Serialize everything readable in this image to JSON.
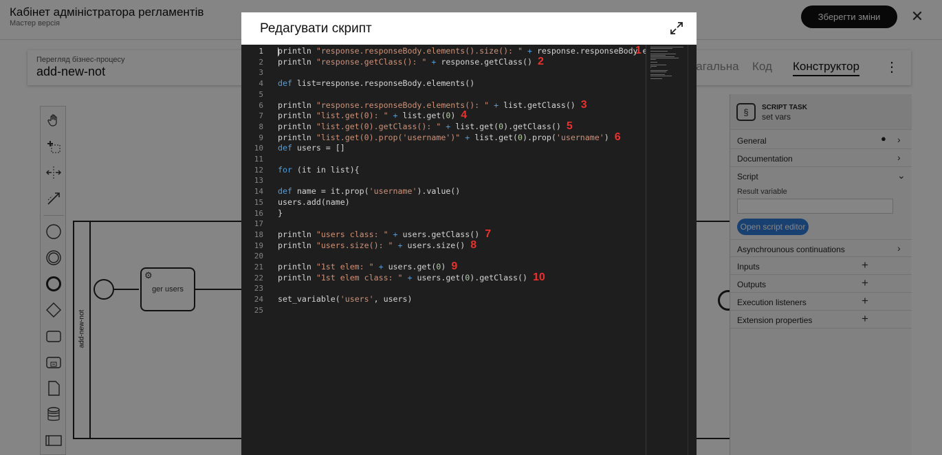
{
  "app": {
    "title": "Кабінет адміністратора регламентів",
    "subtitle": "Мастер версія",
    "save_label": "Зберегти зміни",
    "close_glyph": "✕"
  },
  "process": {
    "label": "Перегляд бізнес-процесу",
    "name": "add-new-not",
    "tabs": [
      "Загальна",
      "Код",
      "Конструктор"
    ],
    "active_tab": "Конструктор",
    "menu_glyph": "⋮"
  },
  "diagram": {
    "pool_name": "add-new-not",
    "task_name": "ger users"
  },
  "properties": {
    "type": "SCRIPT TASK",
    "name": "set vars",
    "groups": {
      "general": "General",
      "documentation": "Documentation",
      "script": "Script",
      "async": "Asynchrounous continuations",
      "inputs": "Inputs",
      "outputs": "Outputs",
      "listeners": "Execution listeners",
      "extensions": "Extension properties"
    },
    "result_variable_label": "Result variable",
    "result_variable_value": "",
    "open_editor_label": "Open script editor",
    "chevron_right": "›",
    "chevron_down": "⌄",
    "plus": "+",
    "dot": "●"
  },
  "modal": {
    "title": "Редагувати скрипт",
    "expand_icon": "expand-icon"
  },
  "editor": {
    "active_line": 1,
    "lines": [
      [
        [
          "kw0",
          "println "
        ],
        [
          "s",
          "\"response.responseBody.elements().size(): \""
        ],
        [
          "o",
          " + "
        ],
        [
          "p",
          "response.responseBody.elements"
        ]
      ],
      [
        [
          "p",
          "println "
        ],
        [
          "s",
          "\"response.getClass(): \""
        ],
        [
          "o",
          " + "
        ],
        [
          "p",
          "response.getClass()"
        ]
      ],
      [],
      [
        [
          "k",
          "def "
        ],
        [
          "p",
          "list=response.responseBody.elements()"
        ]
      ],
      [],
      [
        [
          "p",
          "println "
        ],
        [
          "s",
          "\"response.responseBody.elements(): \""
        ],
        [
          "o",
          " + "
        ],
        [
          "p",
          "list.getClass()"
        ]
      ],
      [
        [
          "p",
          "println "
        ],
        [
          "s",
          "\"list.get(0): \""
        ],
        [
          "o",
          " + "
        ],
        [
          "p",
          "list.get("
        ],
        [
          "n",
          "0"
        ],
        [
          "p",
          ")"
        ]
      ],
      [
        [
          "p",
          "println "
        ],
        [
          "s",
          "\"list.get(0).getClass(): \""
        ],
        [
          "o",
          " + "
        ],
        [
          "p",
          "list.get("
        ],
        [
          "n",
          "0"
        ],
        [
          "p",
          ").getClass()"
        ]
      ],
      [
        [
          "p",
          "println "
        ],
        [
          "s",
          "\"list.get(0).prop('username')\""
        ],
        [
          "o",
          " + "
        ],
        [
          "p",
          "list.get("
        ],
        [
          "n",
          "0"
        ],
        [
          "p",
          ").prop("
        ],
        [
          "s",
          "'username'"
        ],
        [
          "p",
          ")"
        ]
      ],
      [
        [
          "k",
          "def "
        ],
        [
          "p",
          "users = []"
        ]
      ],
      [],
      [
        [
          "k",
          "for "
        ],
        [
          "p",
          "(it in list){"
        ]
      ],
      [],
      [
        [
          "k",
          "def "
        ],
        [
          "p",
          "name = it.prop("
        ],
        [
          "s",
          "'username'"
        ],
        [
          "p",
          ").value()"
        ]
      ],
      [
        [
          "p",
          "users.add(name)"
        ]
      ],
      [
        [
          "p",
          "}"
        ]
      ],
      [],
      [
        [
          "p",
          "println "
        ],
        [
          "s",
          "\"users class: \""
        ],
        [
          "o",
          " + "
        ],
        [
          "p",
          "users.getClass()"
        ]
      ],
      [
        [
          "p",
          "println "
        ],
        [
          "s",
          "\"users.size(): \""
        ],
        [
          "o",
          " + "
        ],
        [
          "p",
          "users.size()"
        ]
      ],
      [],
      [
        [
          "p",
          "println "
        ],
        [
          "s",
          "\"1st elem: \""
        ],
        [
          "o",
          " + "
        ],
        [
          "p",
          "users.get("
        ],
        [
          "n",
          "0"
        ],
        [
          "p",
          ")"
        ]
      ],
      [
        [
          "p",
          "println "
        ],
        [
          "s",
          "\"1st elem class: \""
        ],
        [
          "o",
          " + "
        ],
        [
          "p",
          "users.get("
        ],
        [
          "n",
          "0"
        ],
        [
          "p",
          ").getClass()"
        ]
      ],
      [],
      [
        [
          "p",
          "set_variable("
        ],
        [
          "s",
          "'users'"
        ],
        [
          "p",
          ", users)"
        ]
      ],
      []
    ],
    "annotations": [
      {
        "line": 1,
        "text": "1"
      },
      {
        "line": 2,
        "text": "2"
      },
      {
        "line": 6,
        "text": "3"
      },
      {
        "line": 7,
        "text": "4"
      },
      {
        "line": 8,
        "text": "5"
      },
      {
        "line": 9,
        "text": "6"
      },
      {
        "line": 18,
        "text": "7"
      },
      {
        "line": 19,
        "text": "8"
      },
      {
        "line": 21,
        "text": "9"
      },
      {
        "line": 22,
        "text": "10"
      }
    ]
  },
  "colors": {
    "keyword": "#569cd6",
    "string": "#ce9178",
    "number": "#b5cea8",
    "annotation": "#e8322e",
    "editor_bg": "#1e1e1e",
    "primary_button": "#2f7ed8"
  }
}
